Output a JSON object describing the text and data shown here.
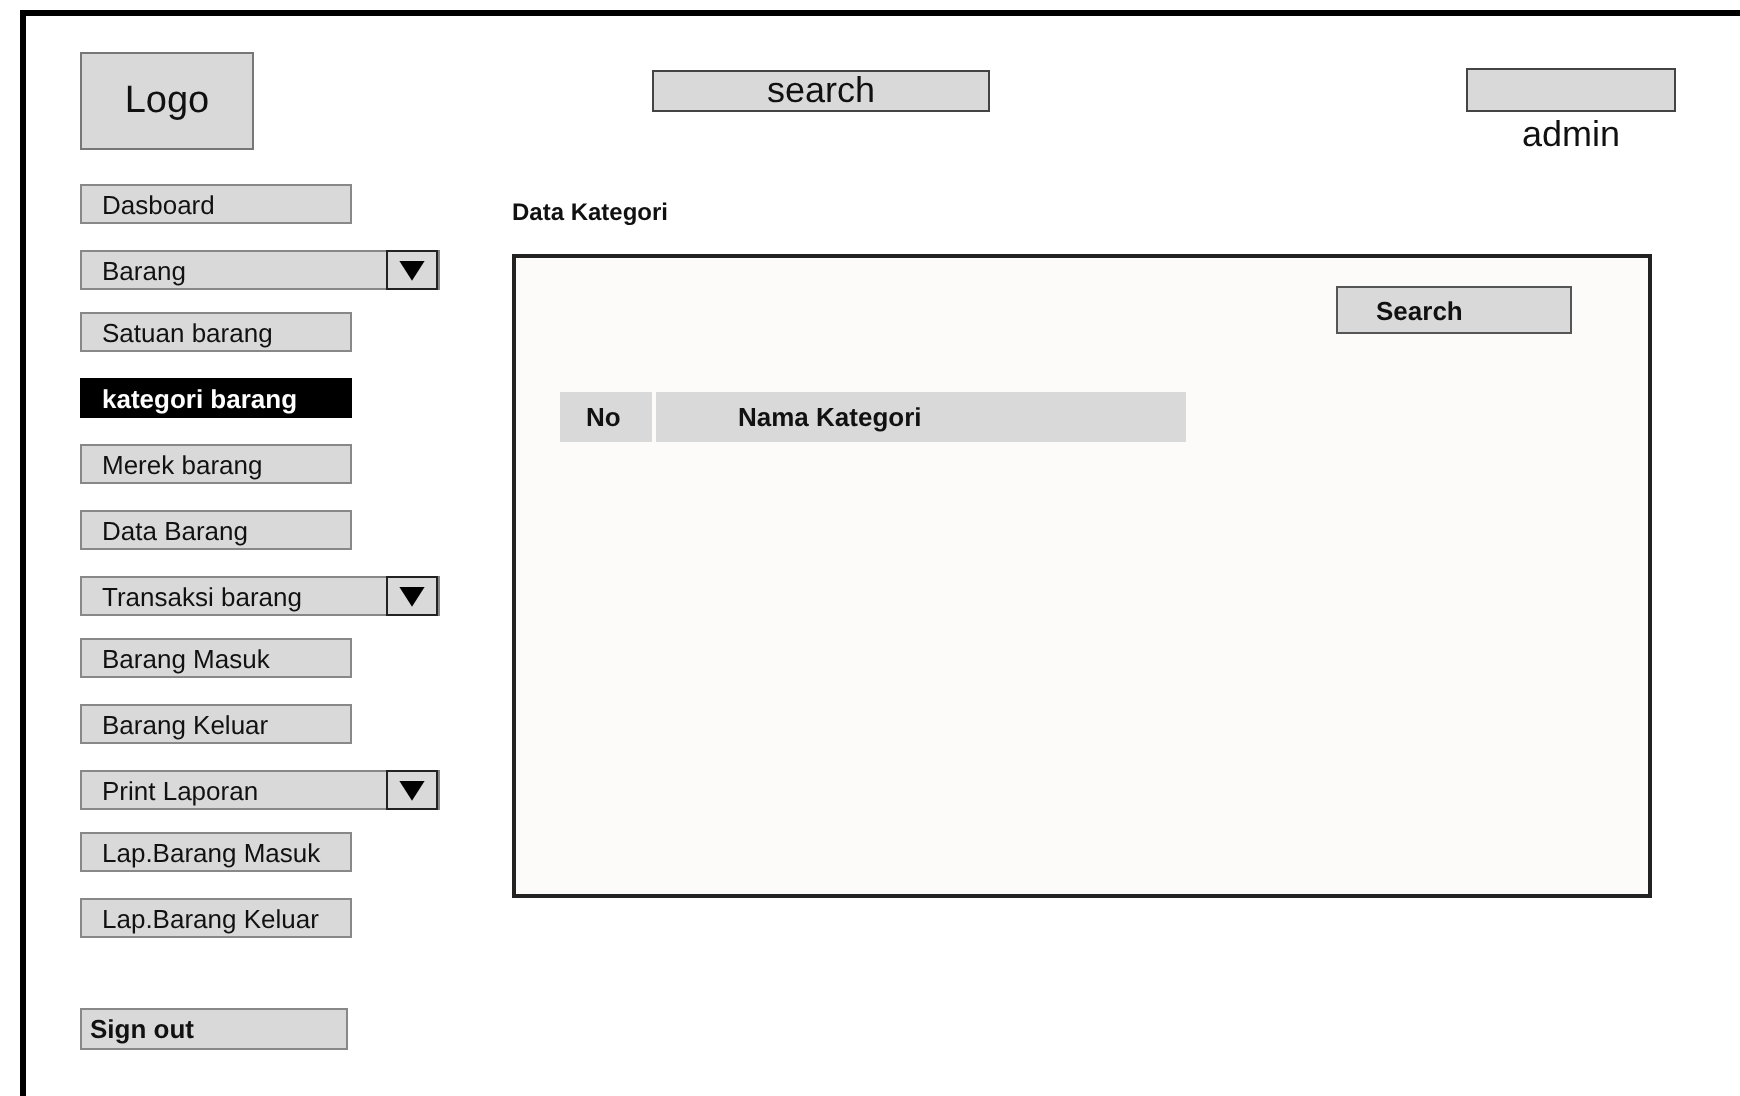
{
  "header": {
    "logo": "Logo",
    "search": {
      "value": "search"
    },
    "user": {
      "name": "admin"
    }
  },
  "sidebar": {
    "items": [
      {
        "label": "Dasboard",
        "kind": "link",
        "selected": false
      },
      {
        "label": "Barang",
        "kind": "dropdown",
        "selected": false
      },
      {
        "label": "Satuan barang",
        "kind": "link",
        "selected": false
      },
      {
        "label": "kategori barang",
        "kind": "link",
        "selected": true
      },
      {
        "label": "Merek barang",
        "kind": "link",
        "selected": false
      },
      {
        "label": "Data Barang",
        "kind": "link",
        "selected": false
      },
      {
        "label": "Transaksi barang",
        "kind": "dropdown",
        "selected": false
      },
      {
        "label": "Barang Masuk",
        "kind": "link",
        "selected": false
      },
      {
        "label": "Barang Keluar",
        "kind": "link",
        "selected": false
      },
      {
        "label": "Print Laporan",
        "kind": "dropdown",
        "selected": false
      },
      {
        "label": "Lap.Barang Masuk",
        "kind": "link",
        "selected": false
      },
      {
        "label": "Lap.Barang Keluar",
        "kind": "link",
        "selected": false
      }
    ],
    "sign_out": "Sign out"
  },
  "main": {
    "title": "Data Kategori",
    "search_button": "Search",
    "table": {
      "columns": [
        "No",
        "Nama Kategori"
      ]
    }
  }
}
